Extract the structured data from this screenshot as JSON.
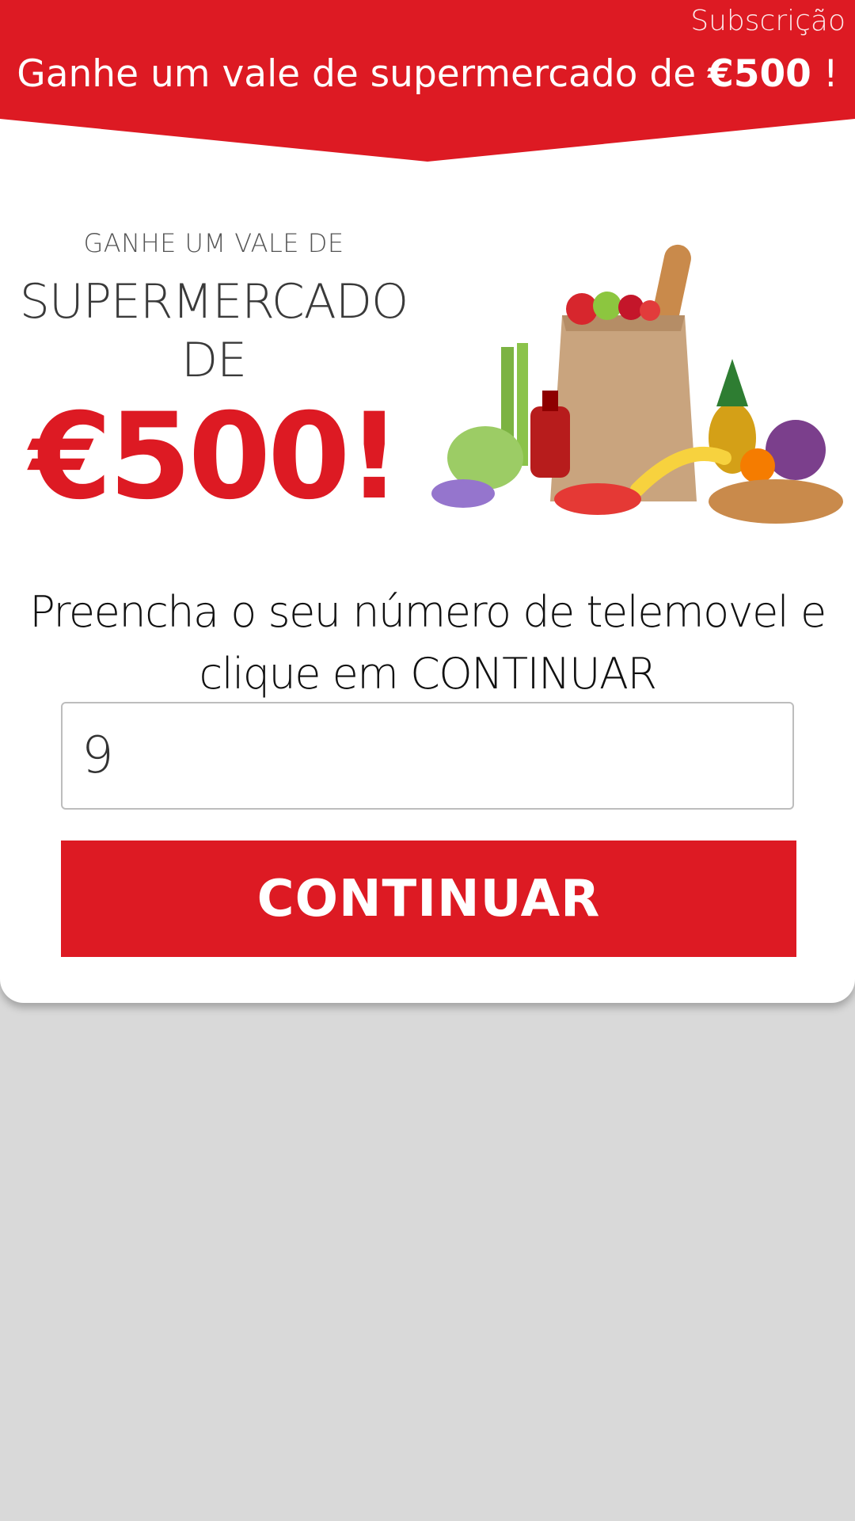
{
  "header": {
    "subscription_link": "Subscrição",
    "headline_text": "Ganhe um vale de supermercado de",
    "headline_amount": "€500",
    "headline_end": "!"
  },
  "promo": {
    "small_line": "GANHE UM VALE DE",
    "big_line_1": "SUPERMERCADO",
    "big_line_2": "DE",
    "amount": "€500!",
    "image_icon": "groceries-bag-illustration"
  },
  "form": {
    "instruction_line_1": "Preencha o seu número de telemovel e",
    "instruction_line_2": "clique em CONTINUAR",
    "phone_value": "9",
    "continue_label": "CONTINUAR"
  },
  "colors": {
    "brand_red": "#dd1a23",
    "background_gray": "#d9d9d9",
    "card_white": "#ffffff"
  }
}
